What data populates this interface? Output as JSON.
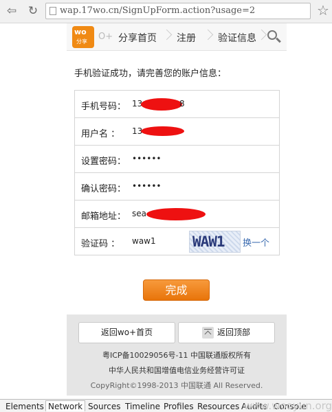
{
  "browser": {
    "url": "wap.17wo.cn/SignUpForm.action?usage=2"
  },
  "header": {
    "logo_text": "wo",
    "logo_sub": "分享",
    "brand_partial": "O+",
    "nav": [
      "分享首页",
      "注册",
      "验证信息"
    ]
  },
  "intro_text": "手机验证成功，请完善您的账户信息：",
  "form": {
    "phone_label": "手机号码：",
    "phone_value_prefix": "13",
    "phone_value_suffix": "8",
    "username_label": "用户名 ：",
    "username_value_prefix": "13",
    "password_label": "设置密码：",
    "password_value": "••••••",
    "confirm_label": "确认密码：",
    "confirm_value": "••••••",
    "email_label": "邮箱地址：",
    "email_value_prefix": "sea",
    "captcha_label": "验证码 ：",
    "captcha_value": "waw1",
    "captcha_image_text": "WAW1",
    "refresh_label": "换一个"
  },
  "submit_label": "完成",
  "footer": {
    "home_button": "返回wo+首页",
    "top_button": "返回顶部",
    "icp": "粤ICP备10029056号-11 中国联通版权所有",
    "license": "中华人民共和国增值电信业务经营许可证",
    "copyright": "CopyRight©1998-2013 中国联通 All Reserved."
  },
  "devtools": {
    "tabs": [
      "Elements",
      "Network",
      "Sources",
      "Timeline",
      "Profiles",
      "Resources",
      "Audits",
      "Console"
    ],
    "active_tab": "Network"
  },
  "watermark": "www.wooyun.org"
}
